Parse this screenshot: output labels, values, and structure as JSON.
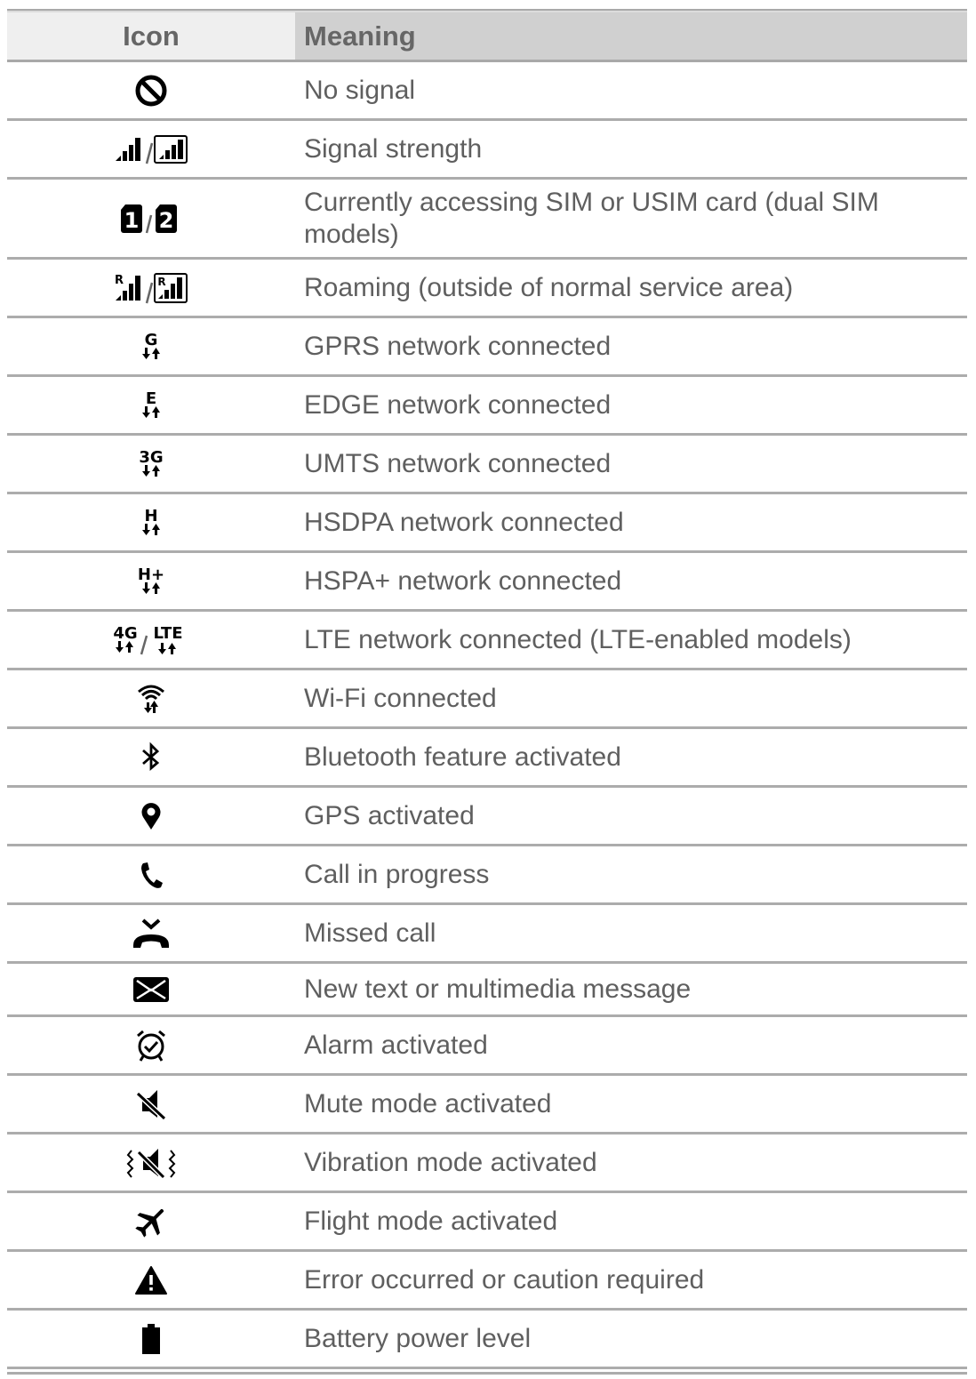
{
  "table": {
    "headers": {
      "icon": "Icon",
      "meaning": "Meaning"
    },
    "rows": [
      {
        "icon": "no-signal-icon",
        "meaning": "No signal"
      },
      {
        "icon": "signal-strength-icon",
        "meaning": "Signal strength"
      },
      {
        "icon": "sim-card-icon",
        "meaning": "Currently accessing SIM or USIM card (dual SIM models)",
        "icon_labels": [
          "1",
          "2"
        ]
      },
      {
        "icon": "roaming-icon",
        "meaning": "Roaming (outside of normal service area)",
        "icon_label": "R"
      },
      {
        "icon": "gprs-icon",
        "meaning": "GPRS network connected",
        "icon_label": "G"
      },
      {
        "icon": "edge-icon",
        "meaning": "EDGE network connected",
        "icon_label": "E"
      },
      {
        "icon": "umts-icon",
        "meaning": "UMTS network connected",
        "icon_label": "3G"
      },
      {
        "icon": "hsdpa-icon",
        "meaning": "HSDPA network connected",
        "icon_label": "H"
      },
      {
        "icon": "hspa-plus-icon",
        "meaning": "HSPA+ network connected",
        "icon_label": "H+"
      },
      {
        "icon": "lte-icon",
        "meaning": "LTE network connected (LTE-enabled models)",
        "icon_labels": [
          "4G",
          "LTE"
        ]
      },
      {
        "icon": "wifi-icon",
        "meaning": "Wi-Fi connected"
      },
      {
        "icon": "bluetooth-icon",
        "meaning": "Bluetooth feature activated"
      },
      {
        "icon": "gps-icon",
        "meaning": "GPS activated"
      },
      {
        "icon": "phone-call-icon",
        "meaning": "Call in progress"
      },
      {
        "icon": "missed-call-icon",
        "meaning": "Missed call"
      },
      {
        "icon": "message-icon",
        "meaning": "New text or multimedia message"
      },
      {
        "icon": "alarm-icon",
        "meaning": "Alarm activated"
      },
      {
        "icon": "mute-icon",
        "meaning": "Mute mode activated"
      },
      {
        "icon": "vibration-icon",
        "meaning": "Vibration mode activated"
      },
      {
        "icon": "flight-mode-icon",
        "meaning": "Flight mode activated"
      },
      {
        "icon": "warning-icon",
        "meaning": "Error occurred or caution required"
      },
      {
        "icon": "battery-icon",
        "meaning": "Battery power level"
      }
    ]
  }
}
